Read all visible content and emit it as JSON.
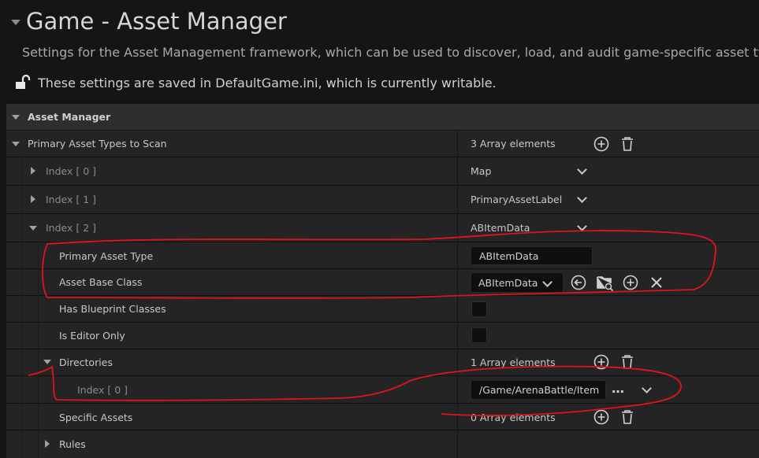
{
  "header": {
    "title": "Game - Asset Manager",
    "subtitle": "Settings for the Asset Management framework, which can be used to discover, load, and audit game-specific asset types",
    "notice": "These settings are saved in DefaultGame.ini, which is currently writable."
  },
  "section": {
    "label": "Asset Manager"
  },
  "primary_asset_types": {
    "label": "Primary Asset Types to Scan",
    "count": "3 Array elements",
    "items": [
      {
        "index_label": "Index [ 0 ]",
        "value": "Map"
      },
      {
        "index_label": "Index [ 1 ]",
        "value": "PrimaryAssetLabel"
      },
      {
        "index_label": "Index [ 2 ]",
        "value": "ABItemData"
      }
    ]
  },
  "item2": {
    "primary_asset_type_label": "Primary Asset Type",
    "primary_asset_type_value": "ABItemData",
    "asset_base_class_label": "Asset Base Class",
    "asset_base_class_value": "ABItemData",
    "has_blueprint_classes_label": "Has Blueprint Classes",
    "is_editor_only_label": "Is Editor Only",
    "directories_label": "Directories",
    "directories_count": "1 Array elements",
    "directory_index_label": "Index [ 0 ]",
    "directory_path": "/Game/ArenaBattle/Item",
    "specific_assets_label": "Specific Assets",
    "specific_assets_count": "0 Array elements",
    "rules_label": "Rules"
  },
  "colors": {
    "annotation": "#e0141a"
  }
}
